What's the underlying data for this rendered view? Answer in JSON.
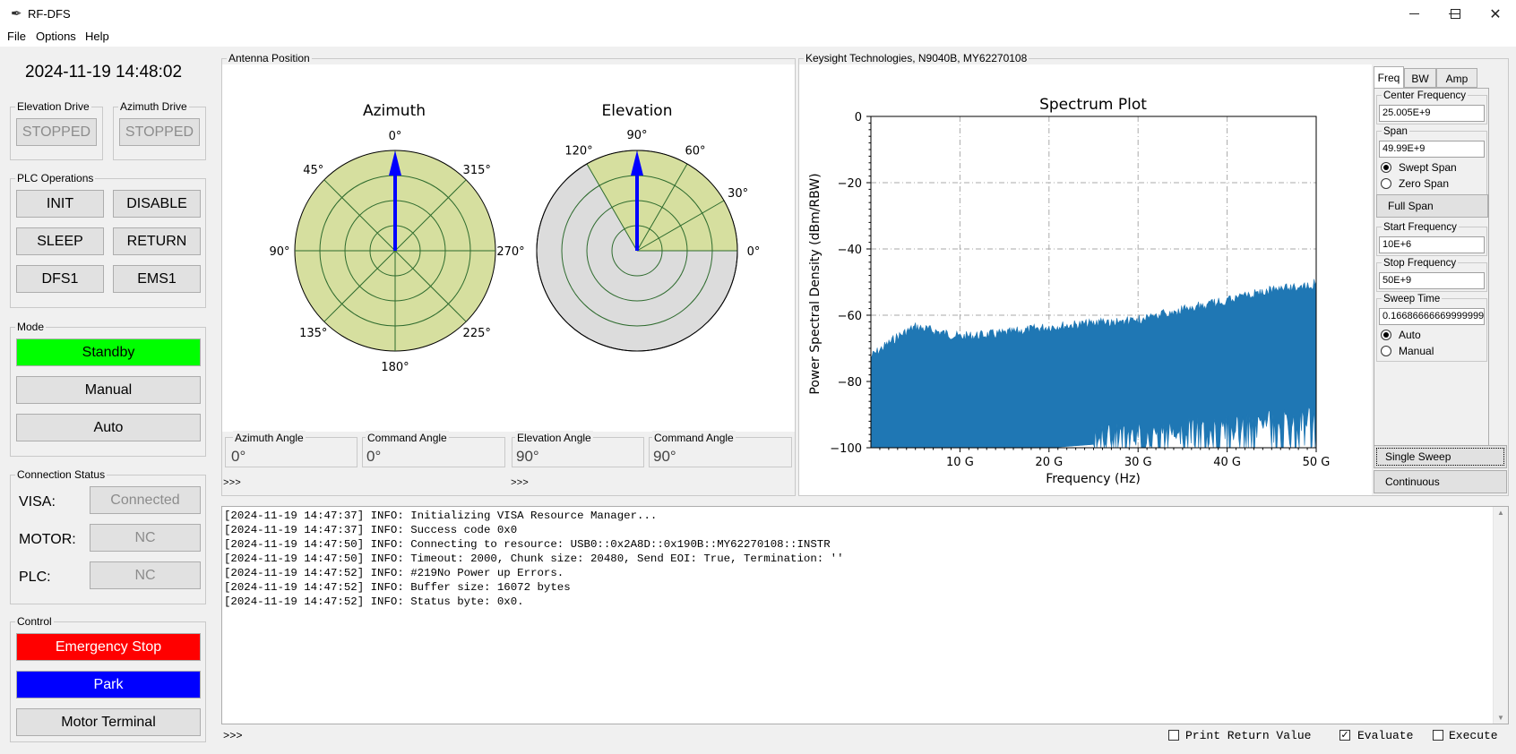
{
  "window": {
    "title": "RF-DFS",
    "minimize": "—",
    "maximize": "☐",
    "close": "✕"
  },
  "menu": [
    "File",
    "Options",
    "Help"
  ],
  "clock": "2024-11-19 14:48:02",
  "elevation_drive": {
    "label": "Elevation Drive",
    "status": "STOPPED"
  },
  "azimuth_drive": {
    "label": "Azimuth Drive",
    "status": "STOPPED"
  },
  "plc_operations": {
    "label": "PLC Operations",
    "buttons": [
      "INIT",
      "DISABLE",
      "SLEEP",
      "RETURN",
      "DFS1",
      "EMS1"
    ]
  },
  "mode": {
    "label": "Mode",
    "buttons": [
      "Standby",
      "Manual",
      "Auto"
    ],
    "active_color": "#00ff00"
  },
  "connection": {
    "label": "Connection Status",
    "rows": [
      {
        "name": "VISA:",
        "value": "Connected"
      },
      {
        "name": "MOTOR:",
        "value": "NC"
      },
      {
        "name": "PLC:",
        "value": "NC"
      }
    ]
  },
  "control": {
    "label": "Control",
    "emergency": "Emergency Stop",
    "emergency_color": "#ff0000",
    "park": "Park",
    "park_color": "#0000ff",
    "terminal": "Motor Terminal"
  },
  "antenna": {
    "label": "Antenna Position",
    "azimuth_title": "Azimuth",
    "elevation_title": "Elevation",
    "az_ticks": [
      "0°",
      "45°",
      "90°",
      "135°",
      "180°",
      "225°",
      "270°",
      "315°"
    ],
    "el_ticks": [
      "120°",
      "90°",
      "60°",
      "30°",
      "0°"
    ],
    "azimuth_deg": 0,
    "elevation_deg": 90,
    "fields": [
      {
        "label": "Azimuth Angle",
        "value": "0°"
      },
      {
        "label": "Command Angle",
        "value": "0°"
      },
      {
        "label": "Elevation Angle",
        "value": "90°"
      },
      {
        "label": "Command Angle",
        "value": "90°"
      }
    ],
    "prompt_left": ">>>",
    "prompt_right": ">>>"
  },
  "analyzer": {
    "label": "Keysight Technologies, N9040B, MY62270108",
    "tabs": [
      "Freq",
      "BW",
      "Amp"
    ],
    "center_frequency_label": "Center Frequency",
    "center_frequency": "25.005E+9",
    "span_label": "Span",
    "span": "49.99E+9",
    "swept_span": "Swept Span",
    "zero_span": "Zero Span",
    "full_span": "Full Span",
    "start_frequency_label": "Start Frequency",
    "start_frequency": "10E+6",
    "stop_frequency_label": "Stop Frequency",
    "stop_frequency": "50E+9",
    "sweep_time_label": "Sweep Time",
    "sweep_time": "0.16686666669999999",
    "auto": "Auto",
    "manual": "Manual",
    "single_sweep": "Single Sweep",
    "continuous": "Continuous"
  },
  "chart_data": {
    "type": "area",
    "title": "Spectrum Plot",
    "xlabel": "Frequency (Hz)",
    "ylabel": "Power Spectral Density (dBm/RBW)",
    "xlim": [
      0,
      50
    ],
    "ylim": [
      -100,
      0
    ],
    "x_ticks": [
      "10 G",
      "20 G",
      "30 G",
      "40 G",
      "50 G"
    ],
    "y_ticks": [
      "0",
      "−20",
      "−40",
      "−60",
      "−80",
      "−100"
    ],
    "color": "#1f77b4",
    "grid": true,
    "upper_envelope": {
      "x": [
        0,
        1,
        3,
        5,
        10,
        15,
        20,
        25,
        30,
        35,
        40,
        45,
        50
      ],
      "y": [
        -71,
        -69,
        -65,
        -62,
        -65,
        -64,
        -62,
        -61,
        -60,
        -57,
        -54,
        -51,
        -49
      ]
    },
    "lower_envelope": {
      "x": [
        0,
        10,
        20,
        30,
        40,
        50
      ],
      "y": [
        -100,
        -100,
        -100,
        -98,
        -96,
        -93
      ]
    }
  },
  "log": {
    "lines": [
      "[2024-11-19 14:47:37] INFO: Initializing VISA Resource Manager...",
      "[2024-11-19 14:47:37] INFO: Success code 0x0",
      "[2024-11-19 14:47:50] INFO: Connecting to resource: USB0::0x2A8D::0x190B::MY62270108::INSTR",
      "[2024-11-19 14:47:50] INFO: Timeout: 2000, Chunk size: 20480, Send EOI: True, Termination: ''",
      "[2024-11-19 14:47:52] INFO: #219No Power up Errors.",
      "[2024-11-19 14:47:52] INFO: Buffer size: 16072 bytes",
      "[2024-11-19 14:47:52] INFO: Status byte: 0x0."
    ],
    "prompt": ">>>",
    "print_return": "Print Return Value",
    "evaluate": "Evaluate",
    "execute": "Execute",
    "evaluate_checked": true
  }
}
